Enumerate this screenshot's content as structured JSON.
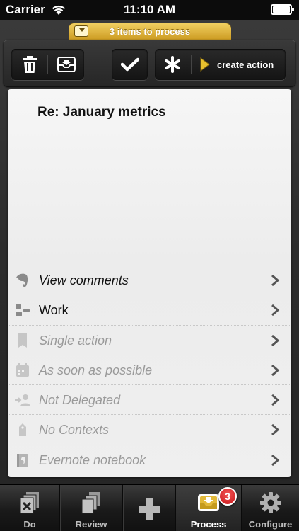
{
  "status_bar": {
    "carrier": "Carrier",
    "time": "11:10 AM"
  },
  "process_tab": {
    "label": "3 items to process"
  },
  "toolbar": {
    "create_action_label": "create action"
  },
  "item": {
    "title": "Re: January metrics"
  },
  "rows": [
    {
      "label": "View comments",
      "style": "italic-dark",
      "icon": "evernote-icon"
    },
    {
      "label": "Work",
      "style": "dark",
      "icon": "area-icon"
    },
    {
      "label": "Single action",
      "style": "italic-gray",
      "icon": "single-action-icon"
    },
    {
      "label": "As soon as possible",
      "style": "italic-gray",
      "icon": "calendar-icon"
    },
    {
      "label": "Not Delegated",
      "style": "italic-gray",
      "icon": "delegate-icon"
    },
    {
      "label": "No Contexts",
      "style": "italic-gray",
      "icon": "context-tag-icon"
    },
    {
      "label": "Evernote notebook",
      "style": "italic-gray",
      "icon": "notebook-icon"
    }
  ],
  "tabbar": {
    "tabs": [
      {
        "label": "Do",
        "icon": "do-icon"
      },
      {
        "label": "Review",
        "icon": "review-icon"
      },
      {
        "label": "",
        "icon": "plus-icon"
      },
      {
        "label": "Process",
        "icon": "inbox-icon",
        "active": true
      },
      {
        "label": "Configure",
        "icon": "gear-icon"
      }
    ],
    "process_badge": "3"
  },
  "colors": {
    "accent_yellow": "#e2b93a",
    "badge_red": "#d91e22"
  }
}
